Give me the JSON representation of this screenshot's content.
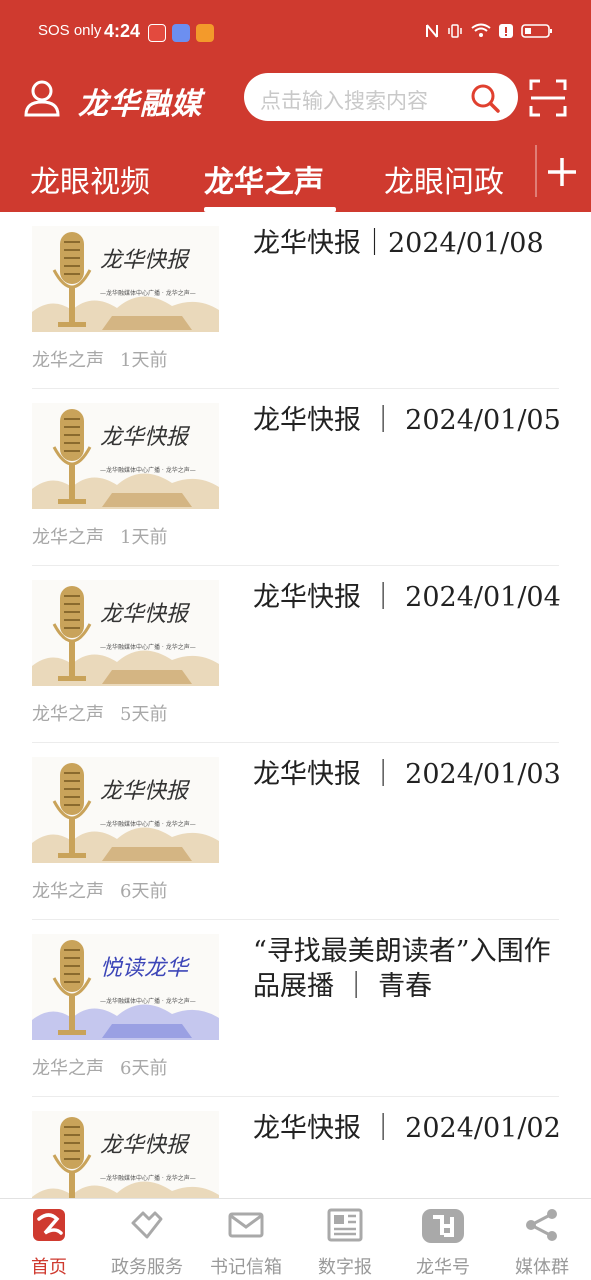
{
  "status_bar": {
    "carrier": "SOS only",
    "time": "4:24"
  },
  "header": {
    "brand": "龙华融媒",
    "search_placeholder": "点击输入搜索内容",
    "accent_color": "#cf3a2f"
  },
  "tabs": [
    {
      "label": "龙眼视频",
      "active": false
    },
    {
      "label": "龙华之声",
      "active": true
    },
    {
      "label": "龙眼问政",
      "active": false
    }
  ],
  "news": [
    {
      "title": "龙华快报｜2024/01/08",
      "source": "龙华之声",
      "time_ago": "1天前",
      "thumb": "龙华快报"
    },
    {
      "title": "龙华快报 ｜ 2024/01/05",
      "source": "龙华之声",
      "time_ago": "1天前",
      "thumb": "龙华快报"
    },
    {
      "title": "龙华快报 ｜ 2024/01/04",
      "source": "龙华之声",
      "time_ago": "5天前",
      "thumb": "龙华快报"
    },
    {
      "title": "龙华快报 ｜ 2024/01/03",
      "source": "龙华之声",
      "time_ago": "6天前",
      "thumb": "龙华快报"
    },
    {
      "title": "“寻找最美朗读者”入围作品展播 ｜ 青春",
      "source": "龙华之声",
      "time_ago": "6天前",
      "thumb": "悦读龙华"
    },
    {
      "title": "龙华快报 ｜ 2024/01/02",
      "source": "",
      "time_ago": "",
      "thumb": "龙华快报"
    }
  ],
  "thumb_caption": "—龙华融媒体中心广播 · 龙华之声—",
  "bottom_nav": [
    {
      "label": "首页",
      "icon": "home-logo-icon",
      "active": true
    },
    {
      "label": "政务服务",
      "icon": "handshake-icon",
      "active": false
    },
    {
      "label": "书记信箱",
      "icon": "mail-icon",
      "active": false
    },
    {
      "label": "数字报",
      "icon": "newspaper-icon",
      "active": false
    },
    {
      "label": "龙华号",
      "icon": "longhua-number-icon",
      "active": false
    },
    {
      "label": "媒体群",
      "icon": "share-icon",
      "active": false
    }
  ]
}
